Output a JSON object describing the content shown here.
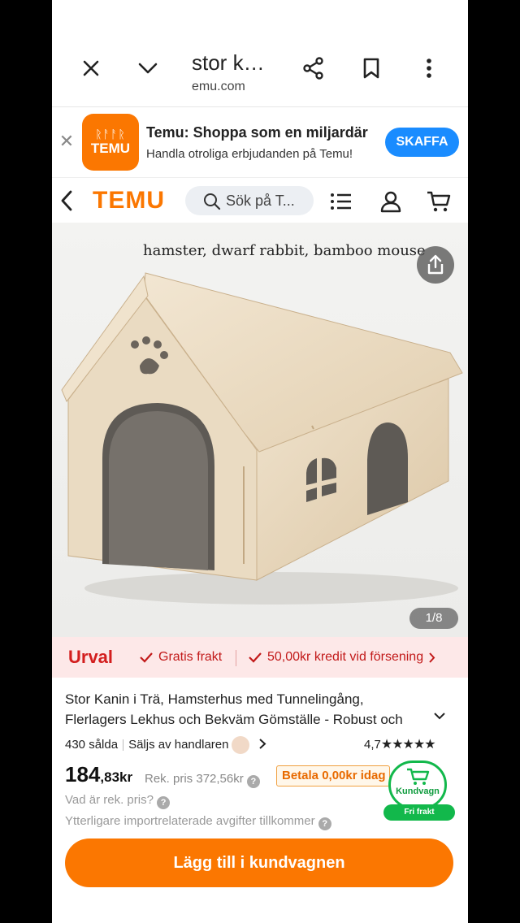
{
  "browser": {
    "tab_title": "stor k…",
    "domain": "emu.com"
  },
  "app_banner": {
    "logo_glyphs": "ᚱᚨᚨᚱ",
    "logo_text": "TEMU",
    "name": "Temu: Shoppa som en miljardär",
    "subtitle": "Handla otroliga erbjudanden på Temu!",
    "get_label": "SKAFFA"
  },
  "site_header": {
    "brand": "TEMU",
    "search_placeholder": "Sök på T..."
  },
  "product_image": {
    "caption": "hamster, dwarf rabbit, bamboo mouse",
    "counter": "1/8"
  },
  "urval": {
    "title": "Urval",
    "free_shipping": "Gratis frakt",
    "delay_credit": "50,00kr kredit vid försening"
  },
  "product": {
    "title_line1": "Stor Kanin i Trä, Hamsterhus med Tunnelingång,",
    "title_line2": "Flerlagers Lekhus och Bekväm Gömställe - Robust och",
    "sold": "430 sålda",
    "seller": "Säljs av handlaren",
    "rating": "4,7",
    "stars": "★★★★★",
    "price_main": "184",
    "price_cents": ",83kr",
    "rek_label": "Rek. pris",
    "rek_price": "372,56kr",
    "pay_badge": "Betala 0,00kr idag",
    "what_rek": "Vad är rek. pris?",
    "import_fees": "Ytterligare importrelaterade avgifter tillkommer"
  },
  "cart_float": {
    "label": "Kundvagn",
    "pill": "Fri frakt"
  },
  "add_to_cart": "Lägg till i kundvagnen",
  "colors": {
    "brand_orange": "#fb7701",
    "get_blue": "#1a8cff",
    "urval_red": "#d31e1e",
    "cart_green": "#12b84b"
  }
}
